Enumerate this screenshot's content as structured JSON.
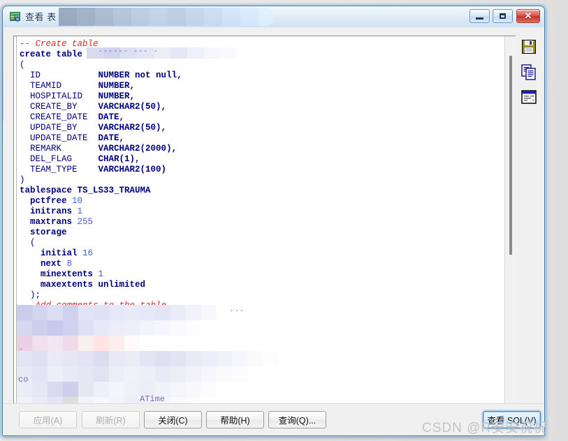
{
  "window": {
    "title": "查看 表",
    "icon": "table-view-icon",
    "controls": {
      "minimize": "minimize-icon",
      "maximize": "maximize-icon",
      "close": "close-icon"
    }
  },
  "editor": {
    "name": "sql-text-area",
    "scrollbar": {
      "name": "vertical-scrollbar"
    },
    "lines": [
      {
        "indent": 0,
        "parts": [
          {
            "t": "-- Create table",
            "c": "cm"
          }
        ]
      },
      {
        "indent": 0,
        "parts": [
          {
            "t": "create table ",
            "c": "kw"
          }
        ],
        "redacted": true
      },
      {
        "indent": 0,
        "parts": [
          {
            "t": "(",
            "c": "pn"
          }
        ]
      },
      {
        "indent": 1,
        "parts": [
          {
            "t": "ID           ",
            "c": "id"
          },
          {
            "t": "NUMBER not null,",
            "c": "ty"
          }
        ]
      },
      {
        "indent": 1,
        "parts": [
          {
            "t": "TEAMID       ",
            "c": "id"
          },
          {
            "t": "NUMBER,",
            "c": "ty"
          }
        ]
      },
      {
        "indent": 1,
        "parts": [
          {
            "t": "HOSPITALID   ",
            "c": "id"
          },
          {
            "t": "NUMBER,",
            "c": "ty"
          }
        ]
      },
      {
        "indent": 1,
        "parts": [
          {
            "t": "CREATE_BY    ",
            "c": "id"
          },
          {
            "t": "VARCHAR2(50),",
            "c": "ty"
          }
        ]
      },
      {
        "indent": 1,
        "parts": [
          {
            "t": "CREATE_DATE  ",
            "c": "id"
          },
          {
            "t": "DATE,",
            "c": "ty"
          }
        ]
      },
      {
        "indent": 1,
        "parts": [
          {
            "t": "UPDATE_BY    ",
            "c": "id"
          },
          {
            "t": "VARCHAR2(50),",
            "c": "ty"
          }
        ]
      },
      {
        "indent": 1,
        "parts": [
          {
            "t": "UPDATE_DATE  ",
            "c": "id"
          },
          {
            "t": "DATE,",
            "c": "ty"
          }
        ]
      },
      {
        "indent": 1,
        "parts": [
          {
            "t": "REMARK       ",
            "c": "id"
          },
          {
            "t": "VARCHAR2(2000),",
            "c": "ty"
          }
        ]
      },
      {
        "indent": 1,
        "parts": [
          {
            "t": "DEL_FLAG     ",
            "c": "id"
          },
          {
            "t": "CHAR(1),",
            "c": "ty"
          }
        ]
      },
      {
        "indent": 1,
        "parts": [
          {
            "t": "TEAM_TYPE    ",
            "c": "id"
          },
          {
            "t": "VARCHAR2(100)",
            "c": "ty"
          }
        ]
      },
      {
        "indent": 0,
        "parts": [
          {
            "t": ")",
            "c": "pn"
          }
        ]
      },
      {
        "indent": 0,
        "parts": [
          {
            "t": "tablespace TS_LS33_TRAUMA",
            "c": "kw"
          }
        ]
      },
      {
        "indent": 1,
        "parts": [
          {
            "t": "pctfree ",
            "c": "kw"
          },
          {
            "t": "10",
            "c": "num"
          }
        ]
      },
      {
        "indent": 1,
        "parts": [
          {
            "t": "initrans ",
            "c": "kw"
          },
          {
            "t": "1",
            "c": "num"
          }
        ]
      },
      {
        "indent": 1,
        "parts": [
          {
            "t": "maxtrans ",
            "c": "kw"
          },
          {
            "t": "255",
            "c": "num"
          }
        ]
      },
      {
        "indent": 1,
        "parts": [
          {
            "t": "storage",
            "c": "kw"
          }
        ]
      },
      {
        "indent": 1,
        "parts": [
          {
            "t": "(",
            "c": "pn"
          }
        ]
      },
      {
        "indent": 2,
        "parts": [
          {
            "t": "initial ",
            "c": "kw"
          },
          {
            "t": "16",
            "c": "num"
          }
        ]
      },
      {
        "indent": 2,
        "parts": [
          {
            "t": "next ",
            "c": "kw"
          },
          {
            "t": "8",
            "c": "num"
          }
        ]
      },
      {
        "indent": 2,
        "parts": [
          {
            "t": "minextents ",
            "c": "kw"
          },
          {
            "t": "1",
            "c": "num"
          }
        ]
      },
      {
        "indent": 2,
        "parts": [
          {
            "t": "maxextents unlimited",
            "c": "kw"
          }
        ]
      },
      {
        "indent": 1,
        "parts": [
          {
            "t": ");",
            "c": "pn"
          }
        ]
      },
      {
        "indent": 0,
        "parts": [
          {
            "t": "-- Add comments to the table",
            "c": "cm"
          }
        ]
      }
    ]
  },
  "tools": [
    {
      "name": "save-icon",
      "label": "save"
    },
    {
      "name": "copy-icon",
      "label": "copy"
    },
    {
      "name": "report-window-icon",
      "label": "report"
    }
  ],
  "buttons": {
    "apply": {
      "label": "应用(A)",
      "state": "disabled"
    },
    "refresh": {
      "label": "刷新(R)",
      "state": "disabled"
    },
    "close": {
      "label": "关闭(C)",
      "state": "enabled"
    },
    "help": {
      "label": "帮助(H)",
      "state": "enabled"
    },
    "query": {
      "label": "查询(Q)...",
      "state": "enabled"
    },
    "view_sql": {
      "label": "查看 SQL(V)",
      "state": "focused"
    }
  },
  "watermark": {
    "text": "CSDN @R安安祝祝"
  },
  "colors": {
    "comment": "#d42a2a",
    "keyword": "#000080",
    "number": "#3f5fd0",
    "title_text": "#17395e",
    "frame_border": "#4b7fae",
    "close_button": "#c6362c"
  }
}
